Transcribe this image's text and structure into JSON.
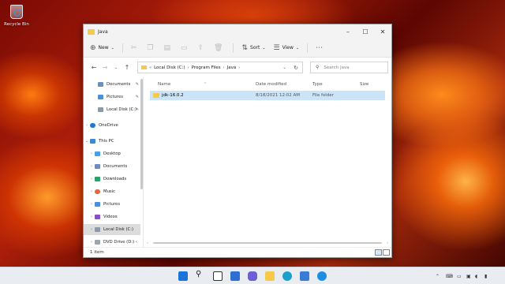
{
  "desktop": {
    "recycle_bin_label": "Recycle Bin"
  },
  "window": {
    "title": "Java"
  },
  "toolbar": {
    "new_label": "New",
    "sort_label": "Sort",
    "view_label": "View"
  },
  "address": {
    "overflow": "«",
    "crumbs": [
      "Local Disk (C:)",
      "Program Files",
      "Java"
    ],
    "search_placeholder": "Search Java"
  },
  "sidebar": {
    "items": [
      {
        "label": "Documents",
        "pinned": true,
        "icon": "documents-icon"
      },
      {
        "label": "Pictures",
        "pinned": true,
        "icon": "pictures-icon"
      },
      {
        "label": "Local Disk (C:)",
        "pinned": true,
        "icon": "drive-icon"
      },
      {
        "label": "OneDrive",
        "icon": "onedrive-icon"
      },
      {
        "label": "This PC",
        "icon": "pc-icon"
      },
      {
        "label": "Desktop",
        "icon": "desktop-folder-icon"
      },
      {
        "label": "Documents",
        "icon": "documents-icon"
      },
      {
        "label": "Downloads",
        "icon": "downloads-icon"
      },
      {
        "label": "Music",
        "icon": "music-icon"
      },
      {
        "label": "Pictures",
        "icon": "pictures-icon"
      },
      {
        "label": "Videos",
        "icon": "videos-icon"
      },
      {
        "label": "Local Disk (C:)",
        "icon": "drive-icon"
      },
      {
        "label": "DVD Drive (D:) ‹",
        "icon": "dvd-icon"
      }
    ]
  },
  "columns": [
    "Name",
    "Date modified",
    "Type",
    "Size"
  ],
  "files": [
    {
      "name": "jdk-16.0.2",
      "date": "8/18/2021 12:02 AM",
      "type": "File folder",
      "size": ""
    }
  ],
  "status": {
    "count": "1 item"
  },
  "colors": {
    "folder": "#f7c948",
    "selection": "#cce4f7",
    "accent": "#0067c0"
  }
}
